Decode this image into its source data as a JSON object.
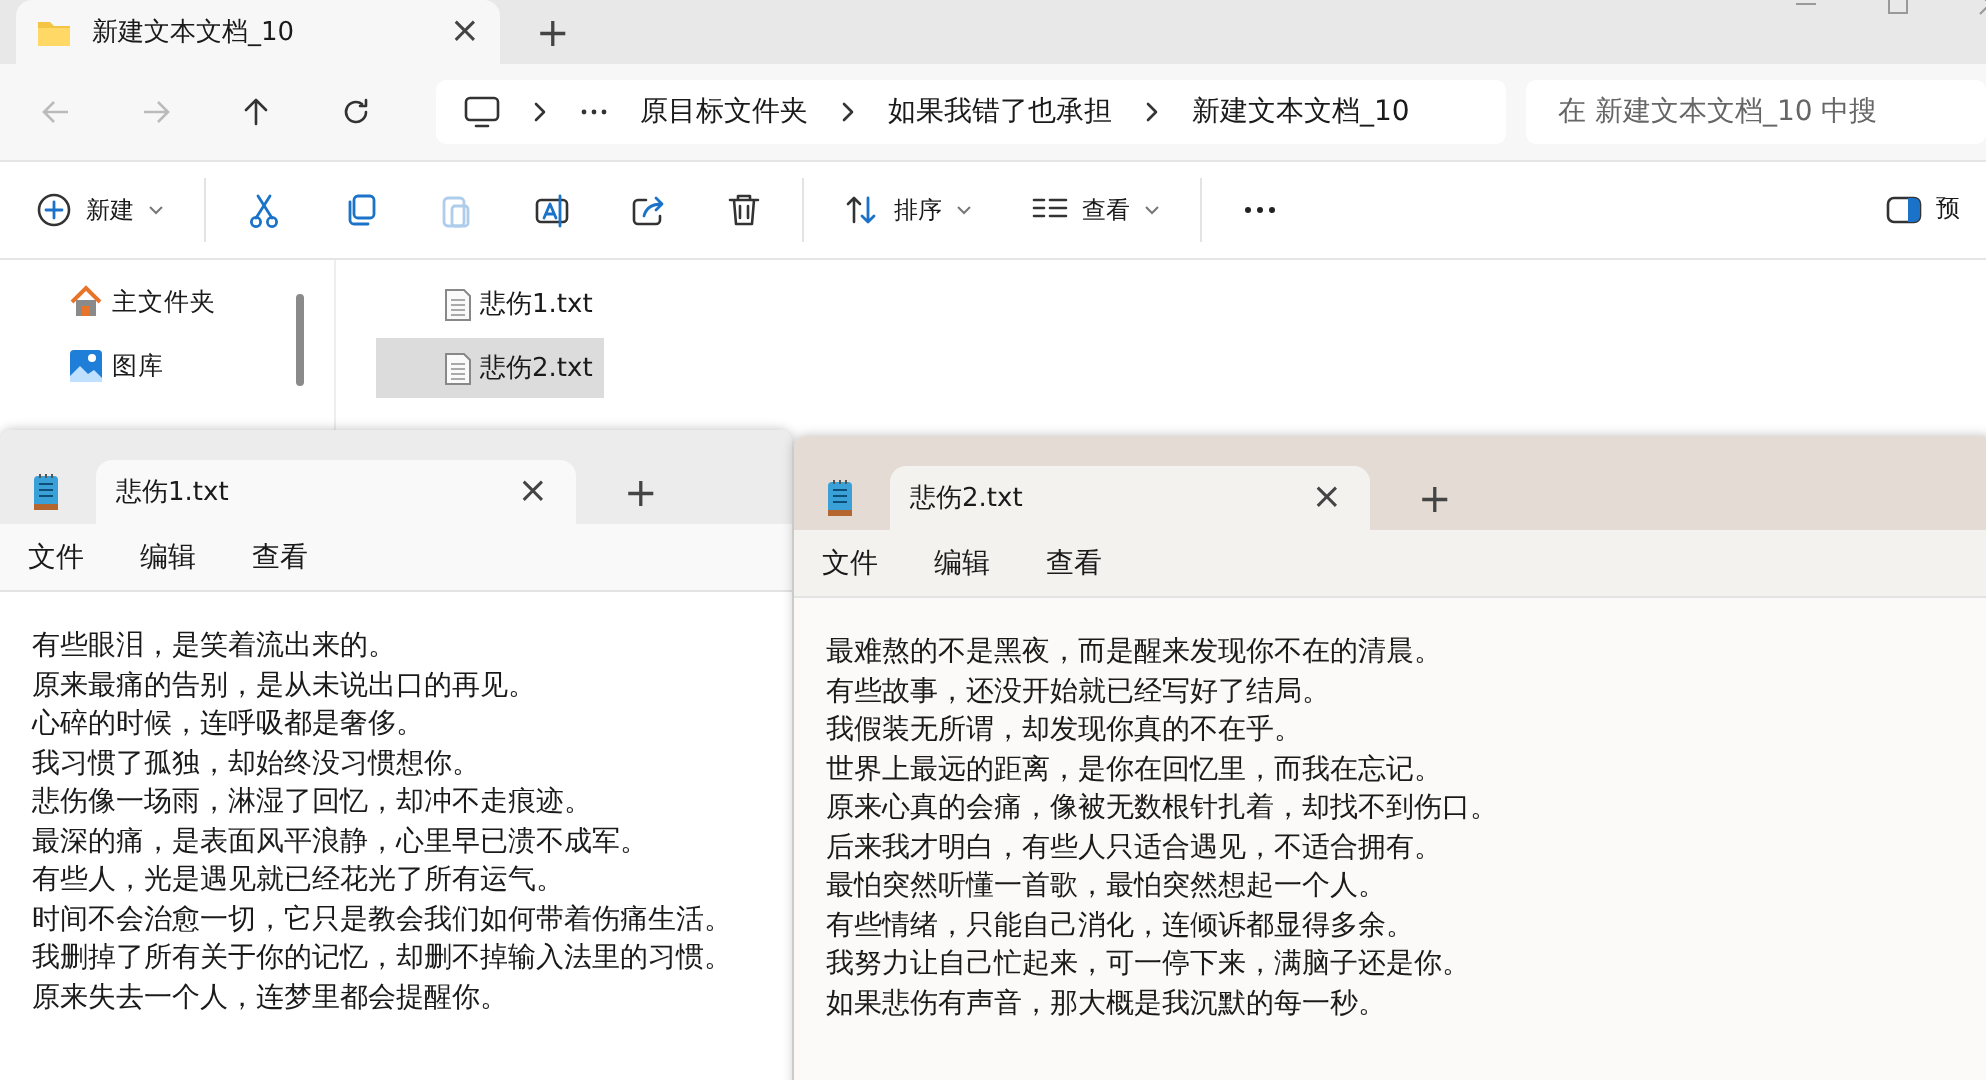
{
  "explorer": {
    "tab": {
      "title": "新建文本文档_10",
      "close": "×"
    },
    "new_tab": "+",
    "breadcrumbs": [
      "原目标文件夹",
      "如果我错了也承担",
      "新建文本文档_10"
    ],
    "search": {
      "placeholder": "在 新建文本文档_10 中搜"
    },
    "toolbar": [
      {
        "kind": "labeled",
        "label": "新建",
        "dropdown": true
      },
      {
        "kind": "icon",
        "disabled": false
      },
      {
        "kind": "icon",
        "disabled": false
      },
      {
        "kind": "icon",
        "disabled": true
      },
      {
        "kind": "icon",
        "disabled": false
      },
      {
        "kind": "icon",
        "disabled": false
      },
      {
        "kind": "icon",
        "disabled": false
      },
      {
        "kind": "labeled",
        "label": "排序",
        "dropdown": true
      },
      {
        "kind": "labeled",
        "label": "查看",
        "dropdown": true
      },
      {
        "kind": "icon",
        "disabled": false
      }
    ],
    "preview": {
      "label": "预"
    },
    "sidebar": [
      {
        "label": "主文件夹"
      },
      {
        "label": "图库"
      }
    ],
    "files": [
      {
        "name": "悲伤1.txt",
        "selected": false
      },
      {
        "name": "悲伤2.txt",
        "selected": true
      }
    ]
  },
  "notepads": [
    {
      "title": "悲伤1.txt",
      "close": "×",
      "new_tab": "+",
      "menu": [
        "文件",
        "编辑",
        "查看"
      ],
      "lines": [
        "有些眼泪，是笑着流出来的。",
        "原来最痛的告别，是从未说出口的再见。",
        "心碎的时候，连呼吸都是奢侈。",
        "我习惯了孤独，却始终没习惯想你。",
        "悲伤像一场雨，淋湿了回忆，却冲不走痕迹。",
        "最深的痛，是表面风平浪静，心里早已溃不成军。",
        "有些人，光是遇见就已经花光了所有运气。",
        "时间不会治愈一切，它只是教会我们如何带着伤痛生活。",
        "我删掉了所有关于你的记忆，却删不掉输入法里的习惯。",
        "原来失去一个人，连梦里都会提醒你。"
      ]
    },
    {
      "title": "悲伤2.txt",
      "close": "×",
      "new_tab": "+",
      "menu": [
        "文件",
        "编辑",
        "查看"
      ],
      "lines": [
        "最难熬的不是黑夜，而是醒来发现你不在的清晨。",
        "有些故事，还没开始就已经写好了结局。",
        "我假装无所谓，却发现你真的不在乎。",
        "世界上最远的距离，是你在回忆里，而我在忘记。",
        "原来心真的会痛，像被无数根针扎着，却找不到伤口。",
        "后来我才明白，有些人只适合遇见，不适合拥有。",
        "最怕突然听懂一首歌，最怕突然想起一个人。",
        "有些情绪，只能自己消化，连倾诉都显得多余。",
        "我努力让自己忙起来，可一停下来，满脑子还是你。",
        "如果悲伤有声音，那大概是我沉默的每一秒。"
      ]
    }
  ]
}
